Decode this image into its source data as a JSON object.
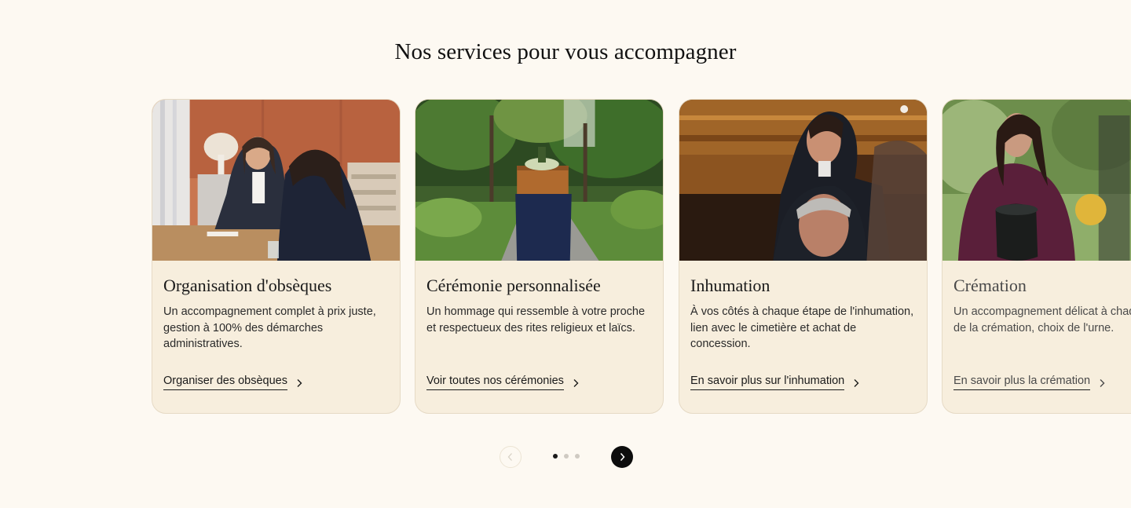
{
  "section": {
    "title": "Nos services pour vous accompagner"
  },
  "cards": [
    {
      "title": "Organisation d'obsèques",
      "description": "Un accompagnement complet à prix juste, gestion à 100% des démarches administratives.",
      "link": "Organiser des obsèques",
      "image": "meeting-photo"
    },
    {
      "title": "Cérémonie personnalisée",
      "description": "Un hommage qui ressemble à votre proche et respectueux des rites religieux et laïcs.",
      "link": "Voir toutes nos cérémonies",
      "image": "garden-ceremony-photo"
    },
    {
      "title": "Inhumation",
      "description": "À vos côtés à chaque étape de l'inhumation, lien avec le cimetière et achat de concession.",
      "link": "En savoir plus sur l'inhumation",
      "image": "coffin-bearers-photo"
    },
    {
      "title": "Crémation",
      "description": "Un accompagnement délicat à chaque étape de la crémation, choix de l'urne.",
      "link": "En savoir plus la crémation",
      "image": "woman-with-urn-photo"
    }
  ],
  "carousel": {
    "prev_icon": "chevron-left-icon",
    "next_icon": "chevron-right-icon",
    "dot_count": 3,
    "active_dot": 1
  },
  "colors": {
    "background": "#fdf9f2",
    "card": "#f7eedd",
    "accent": "#0d0d0d"
  }
}
